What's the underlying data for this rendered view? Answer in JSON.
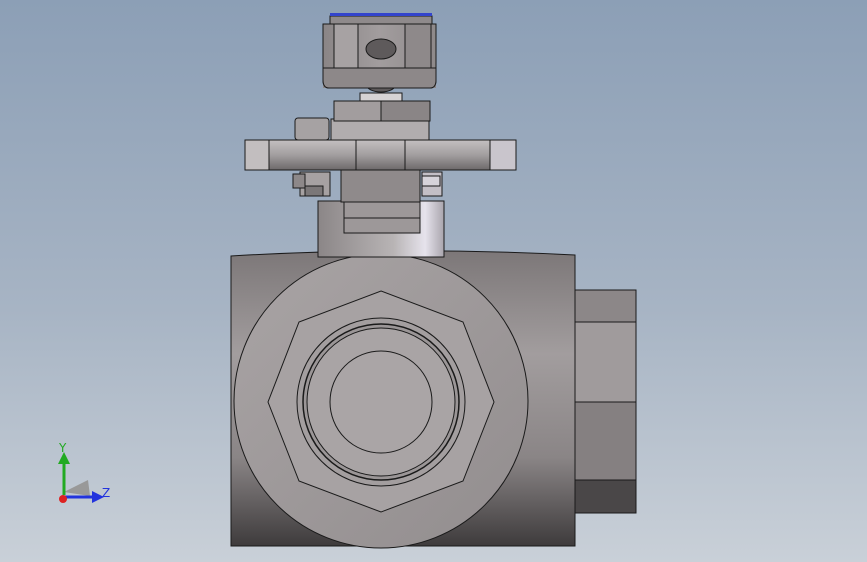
{
  "viewport": {
    "background_top": "#8c9fb6",
    "background_bottom": "#c9d0d8"
  },
  "model": {
    "part_color": "#8f8a8b",
    "edge_color": "#1a1a1a",
    "highlight_color": "#3344cc"
  },
  "triad": {
    "x_label": "",
    "y_label": "Y",
    "z_label": "Z",
    "y_color": "#22aa22",
    "z_color": "#2233dd",
    "x_color": "#dd2222"
  }
}
